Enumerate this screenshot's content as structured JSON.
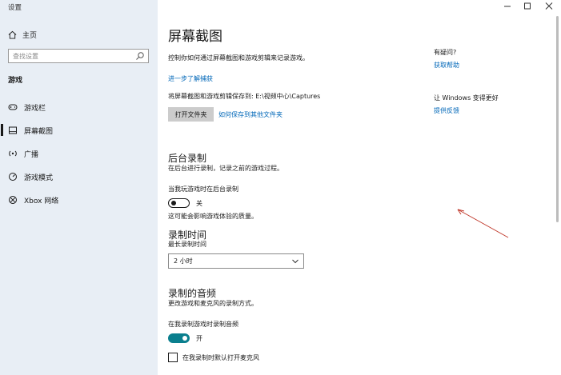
{
  "window": {
    "title": "设置"
  },
  "sidebar": {
    "home_label": "主页",
    "search_placeholder": "查找设置",
    "section_label": "游戏",
    "items": [
      {
        "label": "游戏栏",
        "icon": "game-bar-icon"
      },
      {
        "label": "屏幕截图",
        "icon": "captures-icon",
        "selected": true
      },
      {
        "label": "广播",
        "icon": "broadcast-icon"
      },
      {
        "label": "游戏模式",
        "icon": "game-mode-icon"
      },
      {
        "label": "Xbox 网络",
        "icon": "xbox-icon"
      }
    ]
  },
  "main": {
    "title": "屏幕截图",
    "intro": "控制你如何通过屏幕截图和游戏剪辑来记录游戏。",
    "learn_more": "进一步了解捕获",
    "save_path": "将屏幕截图和游戏剪辑保存到: E:\\视频中心\\Captures",
    "open_folder_button": "打开文件夹",
    "save_elsewhere_link": "如何保存到其他文件夹",
    "background_recording": {
      "heading": "后台录制",
      "description": "在后台进行录制，记录之前的游戏过程。",
      "toggle_label": "当我玩游戏时在后台录制",
      "toggle_state": "关",
      "toggle_on": false,
      "note": "这可能会影响游戏体验的质量。"
    },
    "recording_time": {
      "heading": "录制时间",
      "subheading": "最长录制时间",
      "selected_value": "2 小时"
    },
    "audio": {
      "heading": "录制的音频",
      "description": "更改游戏和麦克风的录制方式。",
      "toggle_label": "在我录制游戏时录制音频",
      "toggle_state": "开",
      "toggle_on": true,
      "checkbox_label": "在我录制时默认打开麦克风",
      "checkbox_checked": false
    }
  },
  "aside": {
    "question": "有疑问?",
    "get_help": "获取帮助",
    "improve": "让 Windows 变得更好",
    "feedback": "提供反馈"
  },
  "colors": {
    "accent": "#0067b8",
    "toggle_on": "#0a7f8e",
    "sidebar_bg": "#e8eef5",
    "annotation_arrow": "#c0392b"
  }
}
